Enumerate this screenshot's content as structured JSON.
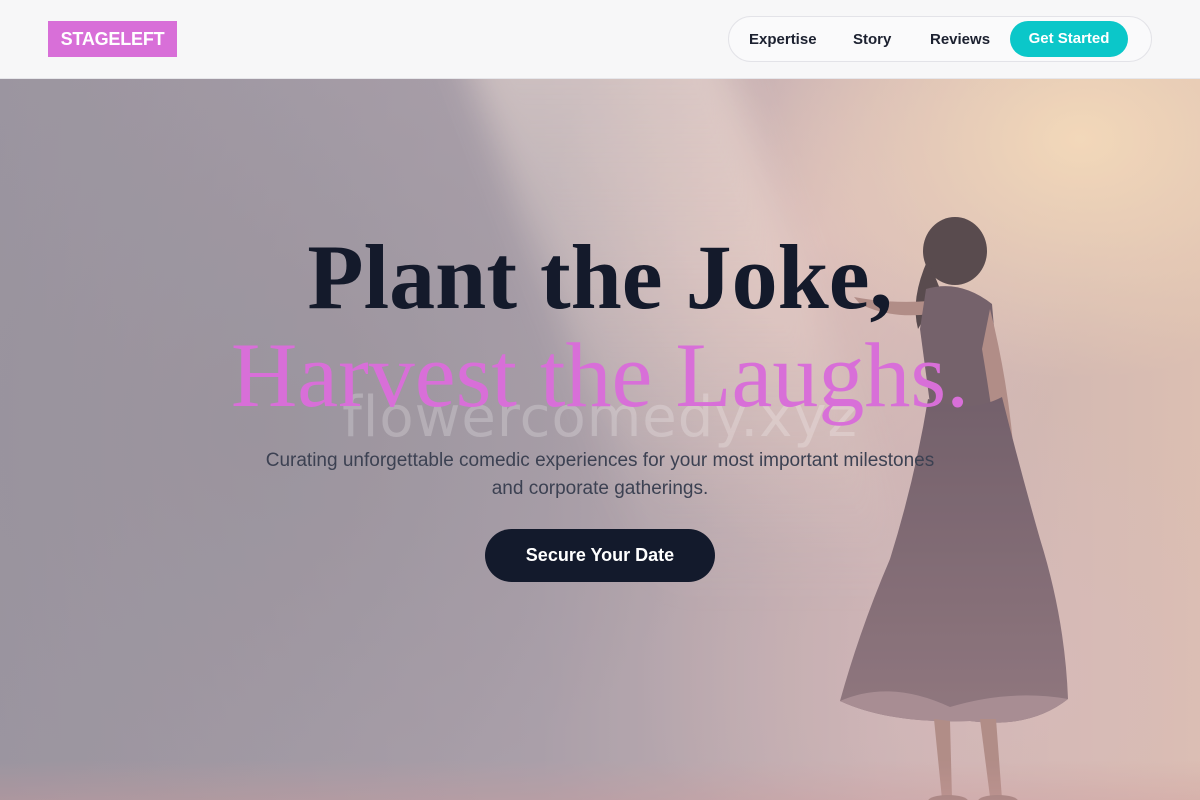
{
  "brand": {
    "logo_text": "STAGELEFT",
    "logo_color": "#d86fd8"
  },
  "nav": {
    "items": [
      {
        "label": "Expertise"
      },
      {
        "label": "Story"
      },
      {
        "label": "Reviews"
      }
    ],
    "cta_label": "Get Started",
    "cta_color": "#0bc7c9"
  },
  "hero": {
    "headline_line1": "Plant the Joke,",
    "headline_line2": "Harvest the Laughs.",
    "watermark": "flowercomedy.xyz",
    "subtitle": "Curating unforgettable comedic experiences for your most important milestones and corporate gatherings.",
    "cta_label": "Secure Your Date",
    "accent_color": "#d86fd8",
    "cta_color": "#131a2c"
  }
}
